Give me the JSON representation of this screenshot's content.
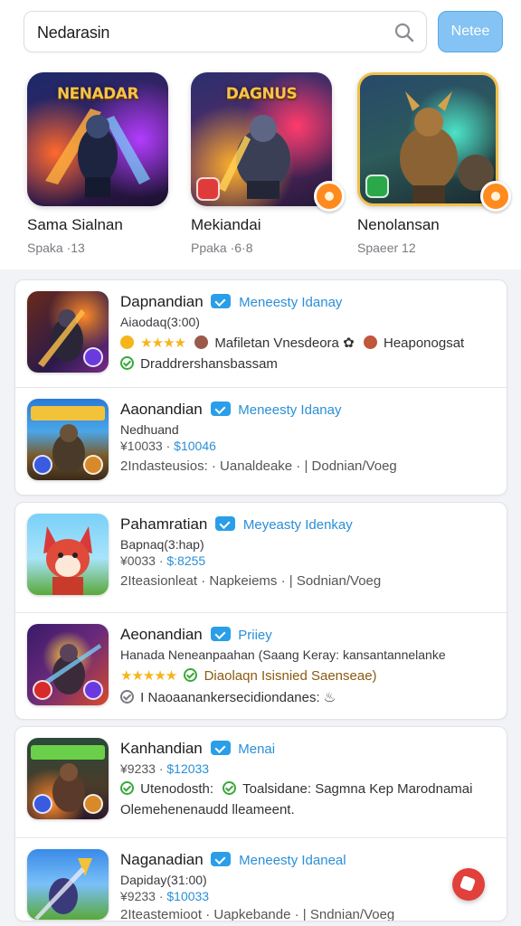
{
  "search": {
    "value": "Nedarasin",
    "button_label": "Netee"
  },
  "featured": [
    {
      "title": "Sama Sialnan",
      "subtitle": "Spaka ·13",
      "banner": "NENADAR"
    },
    {
      "title": "Mekiandai",
      "subtitle": "Ppaka ·6·8",
      "banner": "DAGNUS"
    },
    {
      "title": "Nenolansan",
      "subtitle": "Spaeer 12",
      "banner": ""
    }
  ],
  "list": [
    {
      "name": "Dapnandian",
      "publisher": "Meneesty Idanay",
      "sub": "Aiaodaq(3:00)",
      "meta_rating": "★★★★",
      "meta_text": "Mafiletan Vnesdeora ✿",
      "meta_right": "Heaponogsat",
      "foot": "Draddrershansbassam"
    },
    {
      "name": "Aaonandian",
      "publisher": "Meneesty Idanay",
      "sub": "Nedhuand",
      "price": "¥10033 · ",
      "price_hl": "$10046",
      "foot": "2Indasteusios: · Uanaldeake · | Dodnian/Voeg"
    },
    {
      "name": "Pahamratian",
      "publisher": "Meyeasty Idenkay",
      "sub": "Bapnaq(3:hap)",
      "price": "¥0033 · ",
      "price_hl": "$:8255",
      "foot": "2Iteasionleat · Napkeiems · | Sodnian/Voeg"
    },
    {
      "name": "Aeonandian",
      "publisher": "Priiey",
      "sub": "Hanada Neneanpaahan (Saang Keray: kansantannelanke",
      "meta_rating": "★★★★★",
      "meta_text": "Diaolaqn Isisnied Saenseae)",
      "foot": "I Naoaanankersecidiondanes: ♨"
    },
    {
      "name": "Kanhandian",
      "publisher": "Menai",
      "sub": "",
      "price": "¥9233 · ",
      "price_hl": "$12033",
      "meta_text": "Utenodosth:",
      "meta_text2": "Toalsidane: Sagmna Kep  Marodnamai",
      "foot": "Olemehenenaudd lleameent."
    },
    {
      "name": "Naganadian",
      "publisher": "Meneesty Idaneal",
      "sub": "Dapiday(31:00)",
      "price": "¥9233 · ",
      "price_hl": "$10033",
      "foot": "2Iteastemioot · Uapkebande · | Sndnian/Voeg"
    }
  ]
}
